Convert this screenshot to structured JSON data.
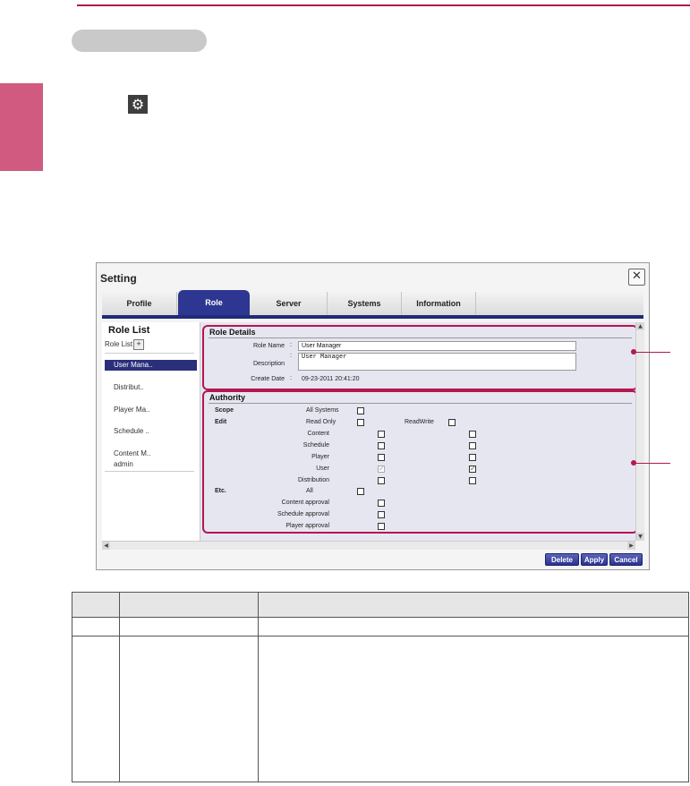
{
  "window": {
    "title": "Setting",
    "close_glyph": "✕",
    "tabs": [
      {
        "label": "Profile",
        "active": false
      },
      {
        "label": "Role",
        "active": true
      },
      {
        "label": "Server",
        "active": false
      },
      {
        "label": "Systems",
        "active": false
      },
      {
        "label": "Information",
        "active": false
      }
    ]
  },
  "role_list": {
    "title": "Role List",
    "subtitle": "Role List",
    "add_glyph": "+",
    "items": [
      "User Mana..",
      "Distribut..",
      "Player Ma..",
      "Schedule ..",
      "Content M..",
      "admin"
    ],
    "selected_index": 0
  },
  "role_details": {
    "title": "Role Details",
    "role_name_label": "Role Name",
    "role_name_value": "User Manager",
    "description_label": "Description",
    "description_value": "User Manager",
    "create_date_label": "Create Date",
    "create_date_value": "09-23-2011 20:41:20",
    "colon": ":"
  },
  "authority": {
    "title": "Authority",
    "scope_label": "Scope",
    "all_systems_label": "All Systems",
    "edit_label": "Edit",
    "read_only_label": "Read Only",
    "read_write_label": "ReadWrite",
    "edit_items": [
      {
        "label": "Content",
        "read_only": false,
        "read_write": false
      },
      {
        "label": "Schedule",
        "read_only": false,
        "read_write": false
      },
      {
        "label": "Player",
        "read_only": false,
        "read_write": false
      },
      {
        "label": "User",
        "read_only": true,
        "read_write": true
      },
      {
        "label": "Distribution",
        "read_only": false,
        "read_write": false
      }
    ],
    "etc_label": "Etc.",
    "all_label": "All",
    "etc_items": [
      "Content approval",
      "Schedule approval",
      "Player approval"
    ]
  },
  "buttons": {
    "delete": "Delete",
    "apply": "Apply",
    "cancel": "Cancel"
  },
  "icons": {
    "gear": "gear-icon",
    "check_glyph": "✓"
  },
  "colors": {
    "accent": "#b0154f",
    "tab_active": "#2d3691",
    "side_tab": "#d05a80"
  }
}
